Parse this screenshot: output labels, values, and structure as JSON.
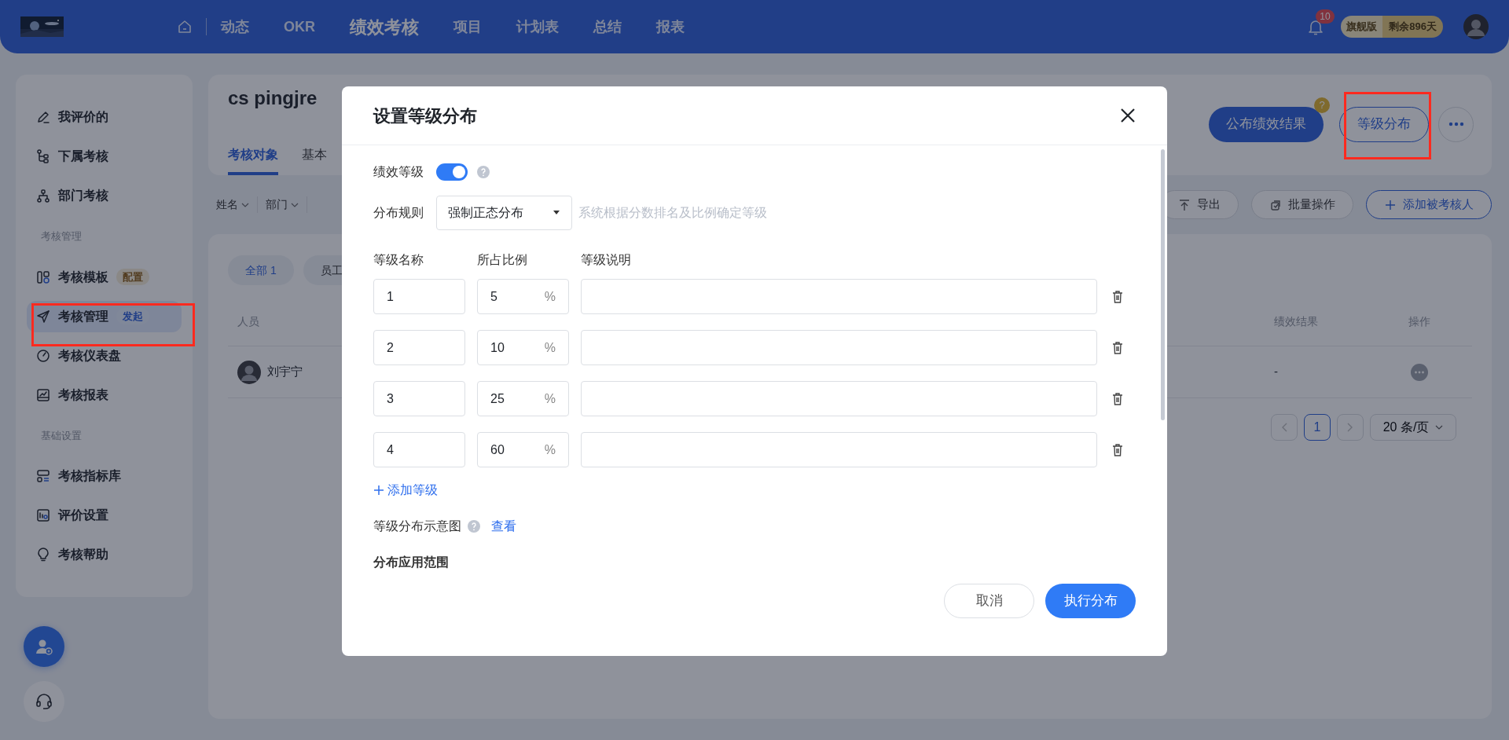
{
  "header": {
    "nav": [
      {
        "label": "动态",
        "selected": false
      },
      {
        "label": "OKR",
        "selected": false
      },
      {
        "label": "绩效考核",
        "selected": true
      },
      {
        "label": "项目",
        "selected": false
      },
      {
        "label": "计划表",
        "selected": false
      },
      {
        "label": "总结",
        "selected": false
      },
      {
        "label": "报表",
        "selected": false
      }
    ],
    "notification_count": "10",
    "plan": {
      "edition": "旗舰版",
      "remaining": "剩余896天"
    }
  },
  "sidebar": {
    "items": [
      {
        "kind": "item",
        "label": "我评价的",
        "selected": false
      },
      {
        "kind": "item",
        "label": "下属考核",
        "selected": false
      },
      {
        "kind": "item",
        "label": "部门考核",
        "selected": false
      },
      {
        "kind": "section",
        "label": "考核管理"
      },
      {
        "kind": "item",
        "label": "考核模板",
        "selected": false,
        "tag": {
          "text": "配置",
          "kind": "config"
        }
      },
      {
        "kind": "item",
        "label": "考核管理",
        "selected": true,
        "tag": {
          "text": "发起",
          "kind": "launch"
        }
      },
      {
        "kind": "item",
        "label": "考核仪表盘",
        "selected": false
      },
      {
        "kind": "item",
        "label": "考核报表",
        "selected": false
      },
      {
        "kind": "section",
        "label": "基础设置"
      },
      {
        "kind": "item",
        "label": "考核指标库",
        "selected": false
      },
      {
        "kind": "item",
        "label": "评价设置",
        "selected": false
      },
      {
        "kind": "item",
        "label": "考核帮助",
        "selected": false
      }
    ]
  },
  "project": {
    "title": "cs pingjre",
    "tabs": [
      {
        "label": "考核对象",
        "selected": true
      },
      {
        "label": "基本",
        "selected": false
      }
    ],
    "actions": [
      {
        "kind": "primary",
        "label": "公布绩效结果",
        "help_badge": "?"
      },
      {
        "kind": "outline",
        "label": "等级分布"
      },
      {
        "kind": "more"
      }
    ]
  },
  "filters": [
    {
      "label": "姓名"
    },
    {
      "label": "部门"
    }
  ],
  "toolbar": [
    {
      "kind": "default",
      "label": "导出"
    },
    {
      "kind": "default",
      "label": "批量操作"
    },
    {
      "kind": "outline",
      "label": "添加被考核人"
    }
  ],
  "table": {
    "groups": [
      {
        "label": "全部 1",
        "selected": true
      },
      {
        "label": "员工",
        "selected": false
      }
    ],
    "columns": [
      "人员",
      "绩效结果",
      "操作"
    ],
    "rows": [
      {
        "person": "刘宇宁",
        "result": "-"
      }
    ],
    "pagination": {
      "pages": [
        {
          "label": "1",
          "selected": true
        }
      ],
      "page_size": "20 条/页"
    }
  },
  "modal": {
    "title": "设置等级分布",
    "grading": {
      "label": "绩效等级",
      "on": true
    },
    "rule": {
      "label": "分布规则",
      "value": "强制正态分布",
      "hint": "系统根据分数排名及比例确定等级"
    },
    "columns": [
      "等级名称",
      "所占比例",
      "等级说明"
    ],
    "levels": [
      {
        "name": "1",
        "ratio": "5",
        "unit": "%"
      },
      {
        "name": "2",
        "ratio": "10",
        "unit": "%"
      },
      {
        "name": "3",
        "ratio": "25",
        "unit": "%"
      },
      {
        "name": "4",
        "ratio": "60",
        "unit": "%"
      }
    ],
    "add_label": "添加等级",
    "chart": {
      "label": "等级分布示意图",
      "link": "查看"
    },
    "scope_title": "分布应用范围",
    "buttons": [
      {
        "kind": "secondary",
        "label": "取消"
      },
      {
        "kind": "primary",
        "label": "执行分布"
      }
    ]
  }
}
